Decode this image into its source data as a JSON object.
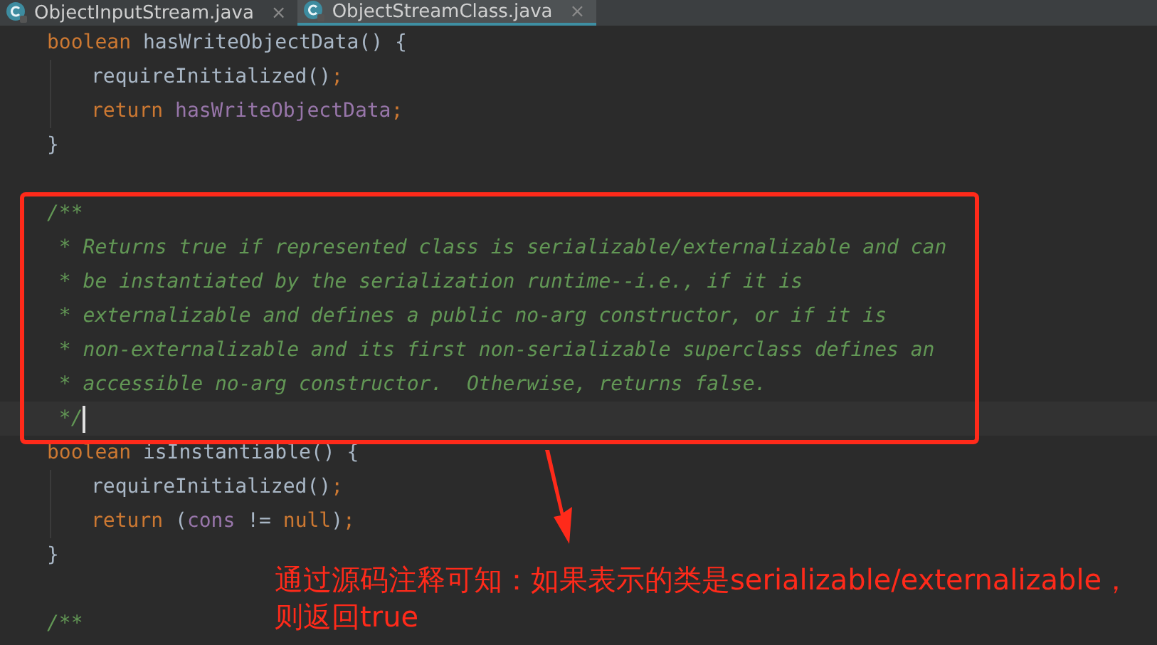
{
  "tabs": [
    {
      "label": "ObjectInputStream.java",
      "close": "×",
      "selected": false
    },
    {
      "label": "ObjectStreamClass.java",
      "close": "×",
      "selected": true
    }
  ],
  "code": [
    {
      "kind": "top",
      "current": false,
      "tokens": [
        {
          "kind": "keyword",
          "text": "boolean "
        },
        {
          "kind": "plain",
          "text": "hasWriteObjectData() {"
        }
      ]
    },
    {
      "kind": "body",
      "current": false,
      "tokens": [
        {
          "kind": "plain",
          "text": "requireInitialized()"
        },
        {
          "kind": "keyword",
          "text": ";"
        }
      ]
    },
    {
      "kind": "body",
      "current": false,
      "tokens": [
        {
          "kind": "keyword",
          "text": "return "
        },
        {
          "kind": "field",
          "text": "hasWriteObjectData"
        },
        {
          "kind": "keyword",
          "text": ";"
        }
      ]
    },
    {
      "kind": "top",
      "current": false,
      "tokens": [
        {
          "kind": "plain",
          "text": "}"
        }
      ]
    },
    {
      "kind": "top",
      "current": false
    },
    {
      "kind": "top",
      "current": false,
      "tokens": [
        {
          "kind": "comment",
          "text": "/**"
        }
      ]
    },
    {
      "kind": "top",
      "current": false,
      "tokens": [
        {
          "kind": "comment",
          "text": " * Returns true if represented class is serializable/externalizable and can"
        }
      ]
    },
    {
      "kind": "top",
      "current": false,
      "tokens": [
        {
          "kind": "comment",
          "text": " * be instantiated by the serialization runtime--i.e., if it is"
        }
      ]
    },
    {
      "kind": "top",
      "current": false,
      "tokens": [
        {
          "kind": "comment",
          "text": " * externalizable and defines a public no-arg constructor, or if it is"
        }
      ]
    },
    {
      "kind": "top",
      "current": false,
      "tokens": [
        {
          "kind": "comment",
          "text": " * non-externalizable and its first non-serializable superclass defines an"
        }
      ]
    },
    {
      "kind": "top",
      "current": false,
      "tokens": [
        {
          "kind": "comment",
          "text": " * accessible no-arg constructor.  Otherwise, returns false."
        }
      ]
    },
    {
      "kind": "top",
      "current": true,
      "tokens": [
        {
          "kind": "comment",
          "text": " */"
        }
      ]
    },
    {
      "kind": "top",
      "current": false,
      "tokens": [
        {
          "kind": "keyword",
          "text": "boolean "
        },
        {
          "kind": "plain",
          "text": "isInstantiable() {"
        }
      ]
    },
    {
      "kind": "body",
      "current": false,
      "tokens": [
        {
          "kind": "plain",
          "text": "requireInitialized()"
        },
        {
          "kind": "keyword",
          "text": ";"
        }
      ]
    },
    {
      "kind": "body",
      "current": false,
      "tokens": [
        {
          "kind": "keyword",
          "text": "return "
        },
        {
          "kind": "plain",
          "text": "("
        },
        {
          "kind": "field",
          "text": "cons"
        },
        {
          "kind": "plain",
          "text": " != "
        },
        {
          "kind": "keyword",
          "text": "null"
        },
        {
          "kind": "plain",
          "text": ")"
        },
        {
          "kind": "keyword",
          "text": ";"
        }
      ]
    },
    {
      "kind": "top",
      "current": false,
      "tokens": [
        {
          "kind": "plain",
          "text": "}"
        }
      ]
    },
    {
      "kind": "top",
      "current": false
    },
    {
      "kind": "top",
      "current": false,
      "tokens": [
        {
          "kind": "comment",
          "text": "/**"
        }
      ]
    }
  ],
  "annotation": {
    "note": "通过源码注释可知：如果表示的类是serializable/externalizable，则返回true"
  }
}
